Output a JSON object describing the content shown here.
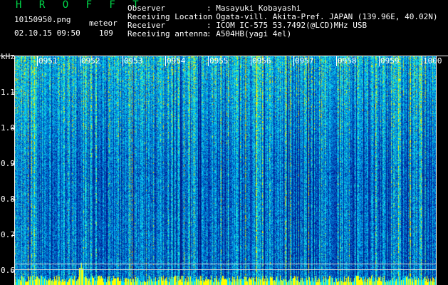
{
  "header": {
    "brand": "H R O F F T",
    "filename": "10150950.png",
    "datetime": "02.10.15 09:50",
    "meteor_label": "meteor",
    "meteor_count": "109",
    "observer_label": "Observer",
    "observer_value": ": Masayuki Kobayashi",
    "location_label": "Receiving Location",
    "location_value": ": Ogata-vill. Akita-Pref. JAPAN (139.96E, 40.02N)",
    "receiver_label": "Receiver",
    "receiver_value": ": ICOM IC-575 53.7492(@LCD)MHz USB",
    "antenna_label": "Receiving antenna",
    "antenna_value": ": A504HB(yagi 4el)"
  },
  "axis": {
    "unit": "kHz",
    "y_ticks": [
      "1.1",
      "1.0",
      "0.9",
      "0.8",
      "0.7",
      "0.6"
    ],
    "x_ticks": [
      "0951",
      "0952",
      "0953",
      "0954",
      "0955",
      "0956",
      "0957",
      "0958",
      "0959",
      "1000"
    ]
  },
  "colors": {
    "background": "#000000",
    "brand": "#00d84a",
    "text": "#ffffff",
    "spectrogram_low": "#001a80",
    "spectrogram_mid": "#00a0ff",
    "spectrogram_high": "#ffff00"
  }
}
